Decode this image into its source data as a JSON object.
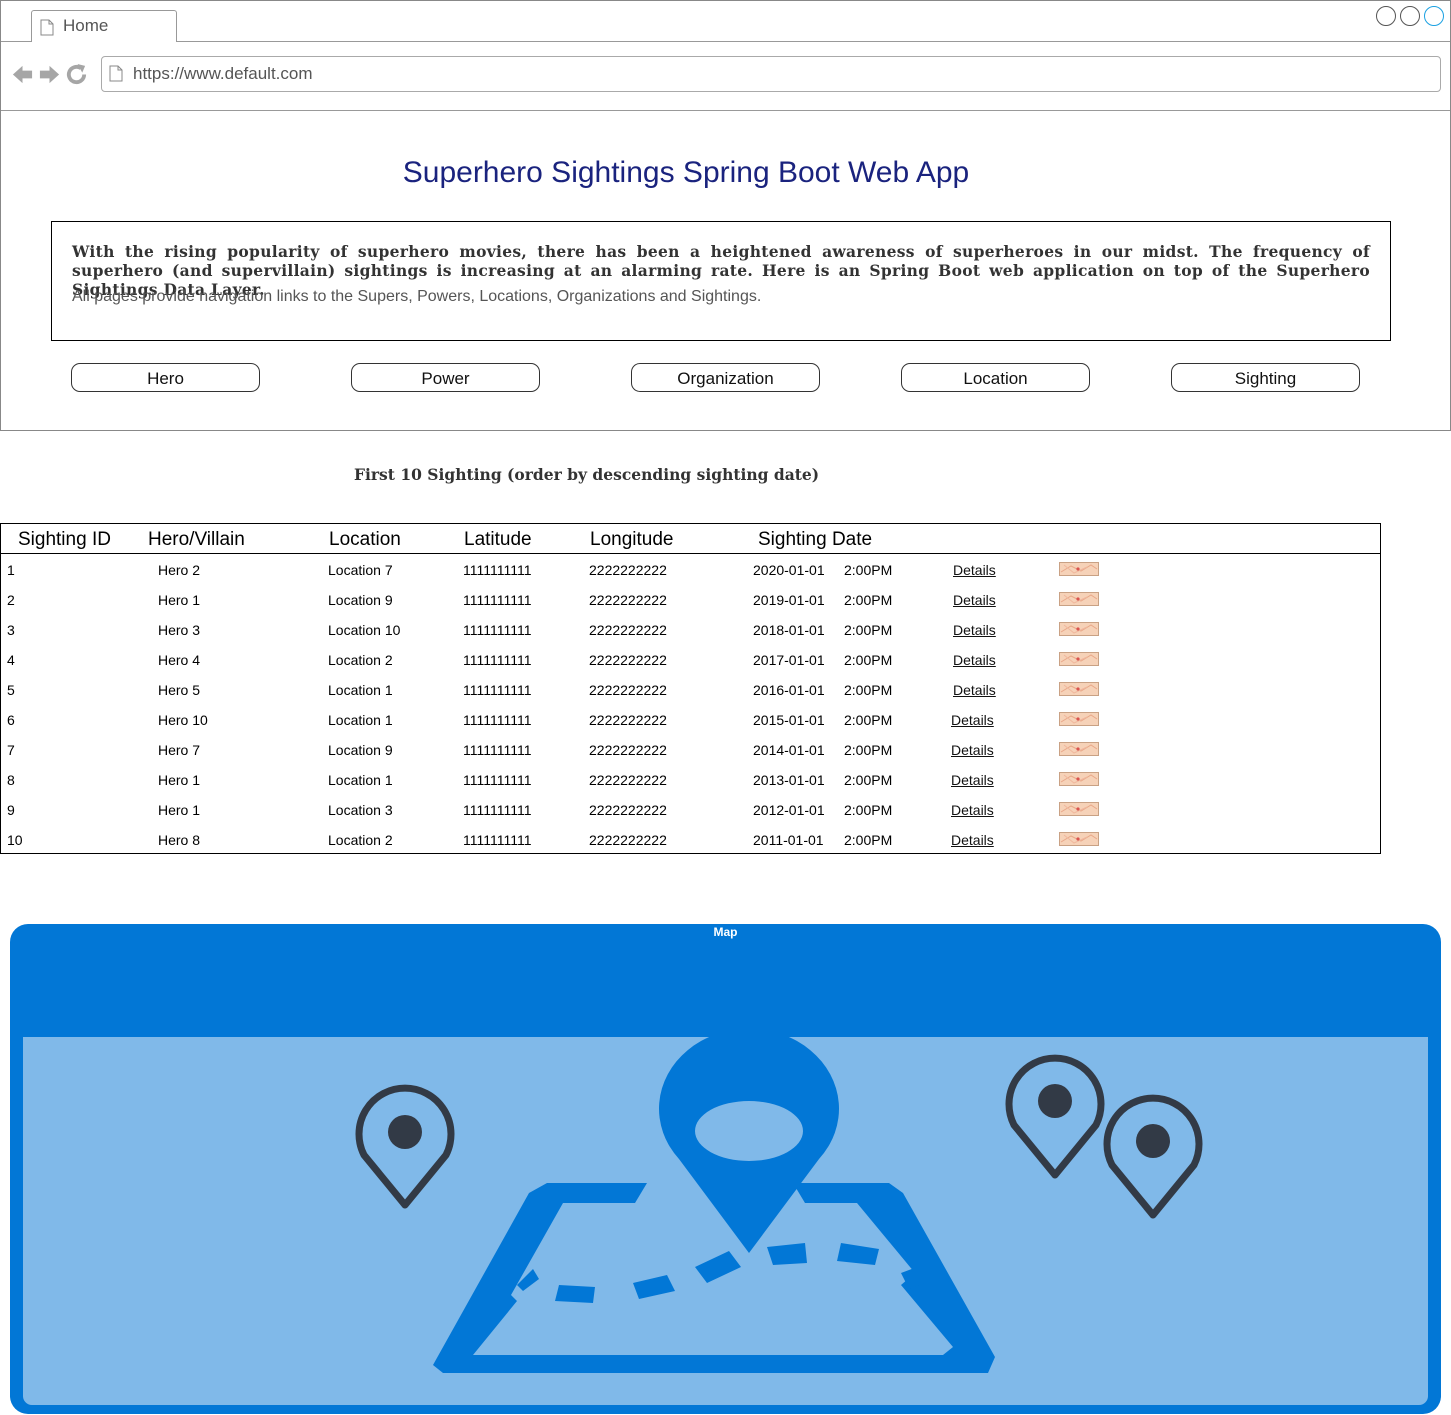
{
  "browser": {
    "tab_label": "Home",
    "url": "https://www.default.com"
  },
  "header": {
    "title": "Superhero Sightings Spring Boot Web App",
    "intro": "With the rising popularity of superhero movies, there has been a heightened awareness of superheroes in our midst. The frequency of superhero (and supervillain) sightings is increasing at an alarming rate. Here is an Spring Boot web application on top of the Superhero Sightings Data Layer.",
    "note": "All pages provide navigation links to the Supers, Powers, Locations, Organizations and Sightings."
  },
  "nav": {
    "hero": "Hero",
    "power": "Power",
    "organization": "Organization",
    "location": "Location",
    "sighting": "Sighting"
  },
  "table": {
    "caption": "First 10 Sighting (order by descending sighting date)",
    "headers": [
      "Sighting ID",
      "Hero/Villain",
      "Location",
      "Latitude",
      "Longitude",
      "Sighting Date"
    ],
    "rows": [
      {
        "id": "1",
        "hero": "Hero 2",
        "location": "Location 7",
        "lat": "1111111111",
        "lng": "2222222222",
        "date": "2020-01-01",
        "time": "2:00PM",
        "details": "Details"
      },
      {
        "id": "2",
        "hero": "Hero 1",
        "location": "Location 9",
        "lat": "1111111111",
        "lng": "2222222222",
        "date": "2019-01-01",
        "time": "2:00PM",
        "details": "Details"
      },
      {
        "id": "3",
        "hero": "Hero 3",
        "location": "Location 10",
        "lat": "1111111111",
        "lng": "2222222222",
        "date": "2018-01-01",
        "time": "2:00PM",
        "details": "Details"
      },
      {
        "id": "4",
        "hero": "Hero 4",
        "location": "Location 2",
        "lat": "1111111111",
        "lng": "2222222222",
        "date": "2017-01-01",
        "time": "2:00PM",
        "details": "Details"
      },
      {
        "id": "5",
        "hero": "Hero 5",
        "location": "Location 1",
        "lat": "1111111111",
        "lng": "2222222222",
        "date": "2016-01-01",
        "time": "2:00PM",
        "details": "Details"
      },
      {
        "id": "6",
        "hero": "Hero 10",
        "location": "Location 1",
        "lat": "1111111111",
        "lng": "2222222222",
        "date": "2015-01-01",
        "time": "2:00PM",
        "details": "Details"
      },
      {
        "id": "7",
        "hero": "Hero 7",
        "location": "Location 9",
        "lat": "1111111111",
        "lng": "2222222222",
        "date": "2014-01-01",
        "time": "2:00PM",
        "details": "Details"
      },
      {
        "id": "8",
        "hero": "Hero 1",
        "location": "Location 1",
        "lat": "1111111111",
        "lng": "2222222222",
        "date": "2013-01-01",
        "time": "2:00PM",
        "details": "Details"
      },
      {
        "id": "9",
        "hero": "Hero 1",
        "location": "Location 3",
        "lat": "1111111111",
        "lng": "2222222222",
        "date": "2012-01-01",
        "time": "2:00PM",
        "details": "Details"
      },
      {
        "id": "10",
        "hero": "Hero 8",
        "location": "Location 2",
        "lat": "1111111111",
        "lng": "2222222222",
        "date": "2011-01-01",
        "time": "2:00PM",
        "details": "Details"
      }
    ]
  },
  "map": {
    "label": "Map"
  },
  "colors": {
    "title": "#1a237e",
    "map_frame": "#0277d6",
    "map_fill": "#80b9e9",
    "pin": "#323a46"
  }
}
